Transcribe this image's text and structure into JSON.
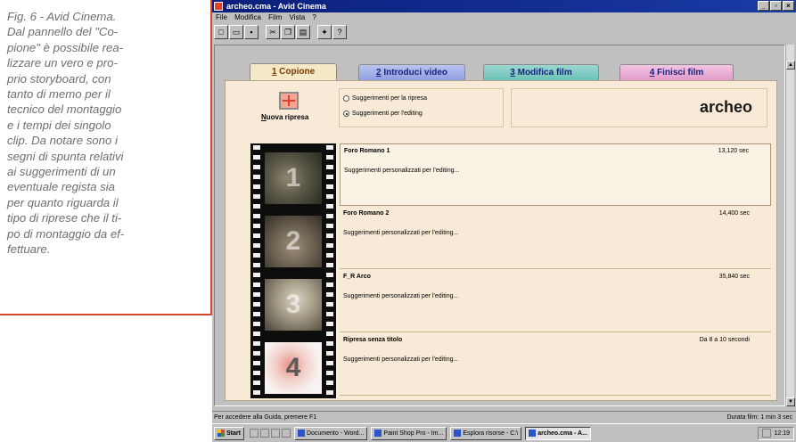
{
  "caption": {
    "lines": [
      "Fig. 6 - Avid Cinema.",
      "Dal pannello del \"Co-",
      "pione\" è possibile rea-",
      "lizzare un vero e pro-",
      "prio storyboard, con",
      "tanto di memo per il",
      "tecnico del montaggio",
      "e i tempi dei singolo",
      "clip. Da notare sono i",
      "segni di spunta relativi",
      "ai suggerimenti di un",
      "eventuale regista sia",
      "per quanto riguarda il",
      "tipo di riprese che il ti-",
      "po di montaggio da ef-",
      "fettuare."
    ]
  },
  "window": {
    "title": "archeo.cma - Avid Cinema",
    "controls": [
      "_",
      "▫",
      "×"
    ]
  },
  "menu": [
    "File",
    "Modifica",
    "Film",
    "Vista",
    "?"
  ],
  "toolbar": {
    "buttons": [
      "new-icon",
      "open-icon",
      "save-icon",
      "cut-icon",
      "copy-icon",
      "paste-icon",
      "wizard-icon",
      "help-icon"
    ]
  },
  "tabs": [
    {
      "num": "1",
      "label": "Copione"
    },
    {
      "num": "2",
      "label": "Introduci video"
    },
    {
      "num": "3",
      "label": "Modifica film"
    },
    {
      "num": "4",
      "label": "Finisci film"
    }
  ],
  "panel": {
    "new_shot_label_prefix": "N",
    "new_shot_label_rest": "uova ripresa",
    "suggestions": {
      "option1": "Suggerimenti per la ripresa",
      "option2": "Suggerimenti per l'editing",
      "selected": 2
    },
    "project_name": "archeo"
  },
  "clips": [
    {
      "num": "1",
      "name": "Foro Romano 1",
      "duration": "13,120 sec",
      "note": "Suggerimenti personalizzati per l'editing..."
    },
    {
      "num": "2",
      "name": "Foro Romano 2",
      "duration": "14,400 sec",
      "note": "Suggerimenti personalizzati per l'editing..."
    },
    {
      "num": "3",
      "name": "F_R Arco",
      "duration": "35,840 sec",
      "note": "Suggerimenti personalizzati per l'editing..."
    },
    {
      "num": "4",
      "name": "Ripresa senza titolo",
      "duration": "Da 8 a 10 secondi",
      "note": "Suggerimenti personalizzati per l'editing..."
    }
  ],
  "status": {
    "left": "Per accedere alla Guida, premere F1",
    "right": "Durata film: 1 min 3 sec"
  },
  "taskbar": {
    "start": "Start",
    "tasks": [
      {
        "label": "Documento - Word...",
        "active": false
      },
      {
        "label": "Paint Shop Pro - Im...",
        "active": false
      },
      {
        "label": "Esplora risorse - C:\\",
        "active": false
      },
      {
        "label": "archeo.cma - A...",
        "active": true
      }
    ],
    "clock": "12:19"
  },
  "colors": {
    "caption_border": "#d9442b",
    "caption_text": "#6e6e6e",
    "panel_bg": "#f8ead6",
    "tab1": "#f6e9c8",
    "tab2": "#8e9fe0",
    "tab3": "#6cc2b7",
    "tab4": "#e29ccb"
  }
}
